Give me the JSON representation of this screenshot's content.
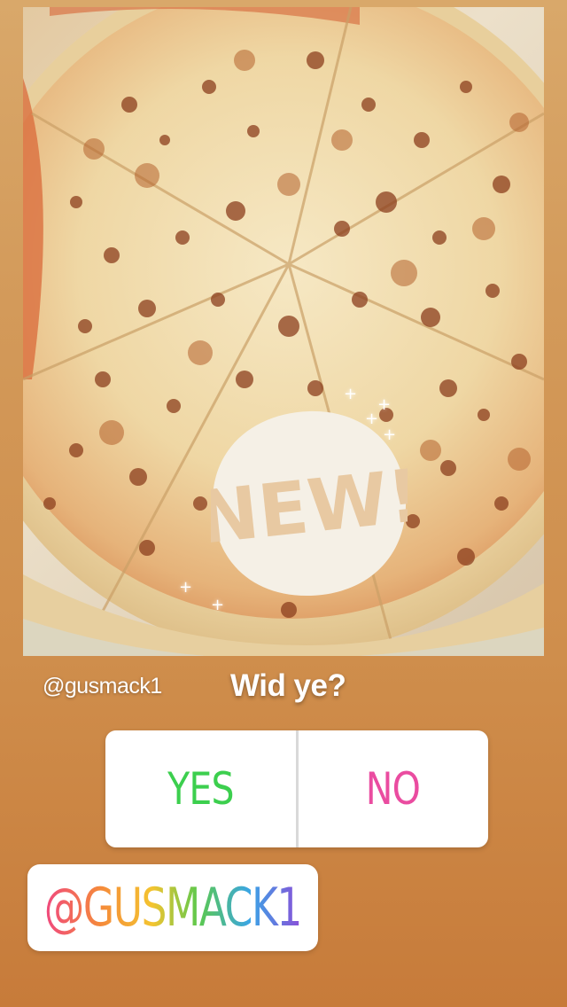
{
  "story": {
    "image_subject": "cheese pizza",
    "sticker_new_text": "NEW!",
    "sparkle_glyph": "+",
    "mention_small": "@gusmack1",
    "poll": {
      "question": "Wid ye?",
      "options": [
        {
          "label": "YES",
          "color": "#3ccf4e"
        },
        {
          "label": "NO",
          "color": "#ea4ca0"
        }
      ]
    },
    "mention_sticker": "@GUSMACK1"
  },
  "colors": {
    "background_top": "#d9a86a",
    "background_bottom": "#c77b3a",
    "sticker_white": "#f5f0e6"
  }
}
